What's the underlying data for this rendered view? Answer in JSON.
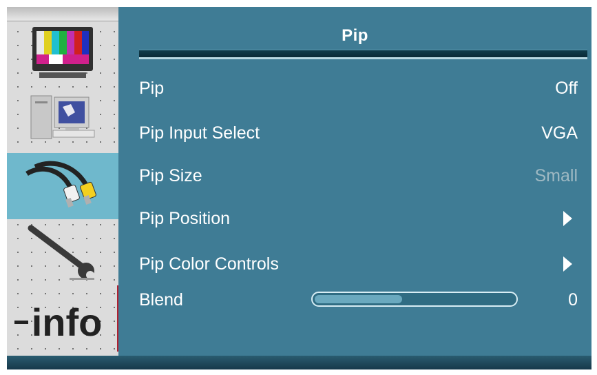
{
  "sidebar": {
    "items": [
      {
        "icon": "tv-color-bars-icon"
      },
      {
        "icon": "computer-icon"
      },
      {
        "icon": "av-cables-icon",
        "active": true
      },
      {
        "icon": "wrench-icon"
      },
      {
        "icon": "info-icon",
        "label": "info"
      }
    ]
  },
  "menu": {
    "title": "Pip",
    "rows": [
      {
        "label": "Pip",
        "value": "Off"
      },
      {
        "label": "Pip Input Select",
        "value": "VGA"
      },
      {
        "label": "Pip Size",
        "value": "Small",
        "disabled": true
      },
      {
        "label": "Pip Position",
        "value_icon": "arrow-right-icon"
      },
      {
        "label": "Pip Color Controls",
        "value_icon": "arrow-right-icon"
      },
      {
        "label": "Blend",
        "value": "0",
        "level_fraction": 0.45
      }
    ]
  },
  "colors": {
    "panel": "#3f7c95",
    "active_item": "#6fb8cc",
    "dim_text": "#9fb9c3"
  }
}
